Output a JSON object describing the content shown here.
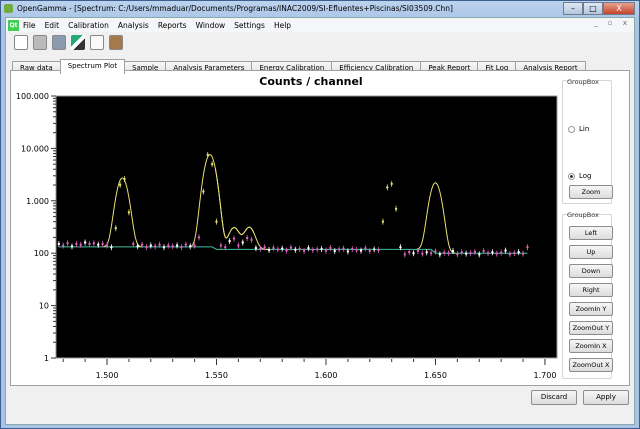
{
  "window": {
    "title": "OpenGamma - [Spectrum: C:/Users/mmaduar/Documents/Programas/INAC2009/SI-Efluentes+Piscinas/SI03509.Chn]",
    "min": "–",
    "max": "□",
    "close": "X"
  },
  "menu": [
    "File",
    "Edit",
    "Calibration",
    "Analysis",
    "Reports",
    "Window",
    "Settings",
    "Help"
  ],
  "mdi_controls": "_ ▫ x",
  "toolbar": [
    "new-icon",
    "open-icon",
    "save-icon",
    "cut-icon",
    "copy-icon",
    "paste-icon"
  ],
  "tabs": [
    "Raw data",
    "Spectrum Plot",
    "Sample",
    "Analysis Parameters",
    "Energy Calibration",
    "Efficiency Calibration",
    "Peak Report",
    "Fit Log",
    "Analysis Report"
  ],
  "active_tab": "Spectrum Plot",
  "scale_group": {
    "title": "GroupBox",
    "lin": "Lin",
    "log": "Log",
    "selected": "Log",
    "zoom": "Zoom"
  },
  "nav_group": {
    "title": "GroupBox",
    "buttons": [
      "Left",
      "Up",
      "Down",
      "Right",
      "ZoomIn Y",
      "ZoomOut Y",
      "ZoomIn X",
      "ZoomOut X"
    ]
  },
  "footer": {
    "discard": "Discard",
    "apply": "Apply"
  },
  "chart_data": {
    "type": "line",
    "title": "Counts / channel",
    "yscale": "log",
    "ylim": [
      1,
      100000
    ],
    "xlim": [
      1.4767,
      1.7055
    ],
    "yticks": [
      1,
      10,
      100,
      1000,
      10000,
      100000
    ],
    "ytick_labels": [
      "1",
      "10",
      "100",
      "1.000",
      "10.000",
      "100.000"
    ],
    "xticks": [
      1.5,
      1.55,
      1.6,
      1.65,
      1.7
    ],
    "xtick_labels": [
      "1.500",
      "1.550",
      "1.600",
      "1.650",
      "1.700"
    ],
    "x_start": 1.478,
    "x_step": 0.002,
    "counts": [
      150,
      140,
      155,
      135,
      150,
      145,
      160,
      150,
      155,
      145,
      150,
      140,
      130,
      300,
      2000,
      2600,
      600,
      150,
      135,
      145,
      130,
      140,
      135,
      145,
      130,
      140,
      135,
      140,
      130,
      145,
      135,
      140,
      200,
      1500,
      7500,
      5000,
      400,
      140,
      130,
      170,
      190,
      140,
      160,
      195,
      180,
      125,
      120,
      130,
      115,
      125,
      118,
      122,
      112,
      128,
      116,
      120,
      110,
      125,
      115,
      118,
      120,
      112,
      126,
      110,
      118,
      122,
      108,
      120,
      115,
      112,
      124,
      110,
      118,
      115,
      400,
      1800,
      2100,
      700,
      130,
      95,
      105,
      100,
      110,
      98,
      104,
      100,
      108,
      95,
      102,
      100,
      110,
      96,
      104,
      98,
      100,
      106,
      95,
      110,
      100,
      104,
      98,
      102,
      112,
      96,
      100,
      105,
      98,
      130
    ],
    "fit_peaks": [
      {
        "center": 1.507,
        "height": 2600
      },
      {
        "center": 1.547,
        "height": 7500
      },
      {
        "center": 1.558,
        "height": 190
      },
      {
        "center": 1.565,
        "height": 195
      },
      {
        "center": 1.65,
        "height": 2100
      }
    ],
    "colors": {
      "background": "#000000",
      "data_low": "#e060c0",
      "data_high": "#ffffff",
      "fit": "#e8e070",
      "baseline": "#40c0a0"
    }
  }
}
